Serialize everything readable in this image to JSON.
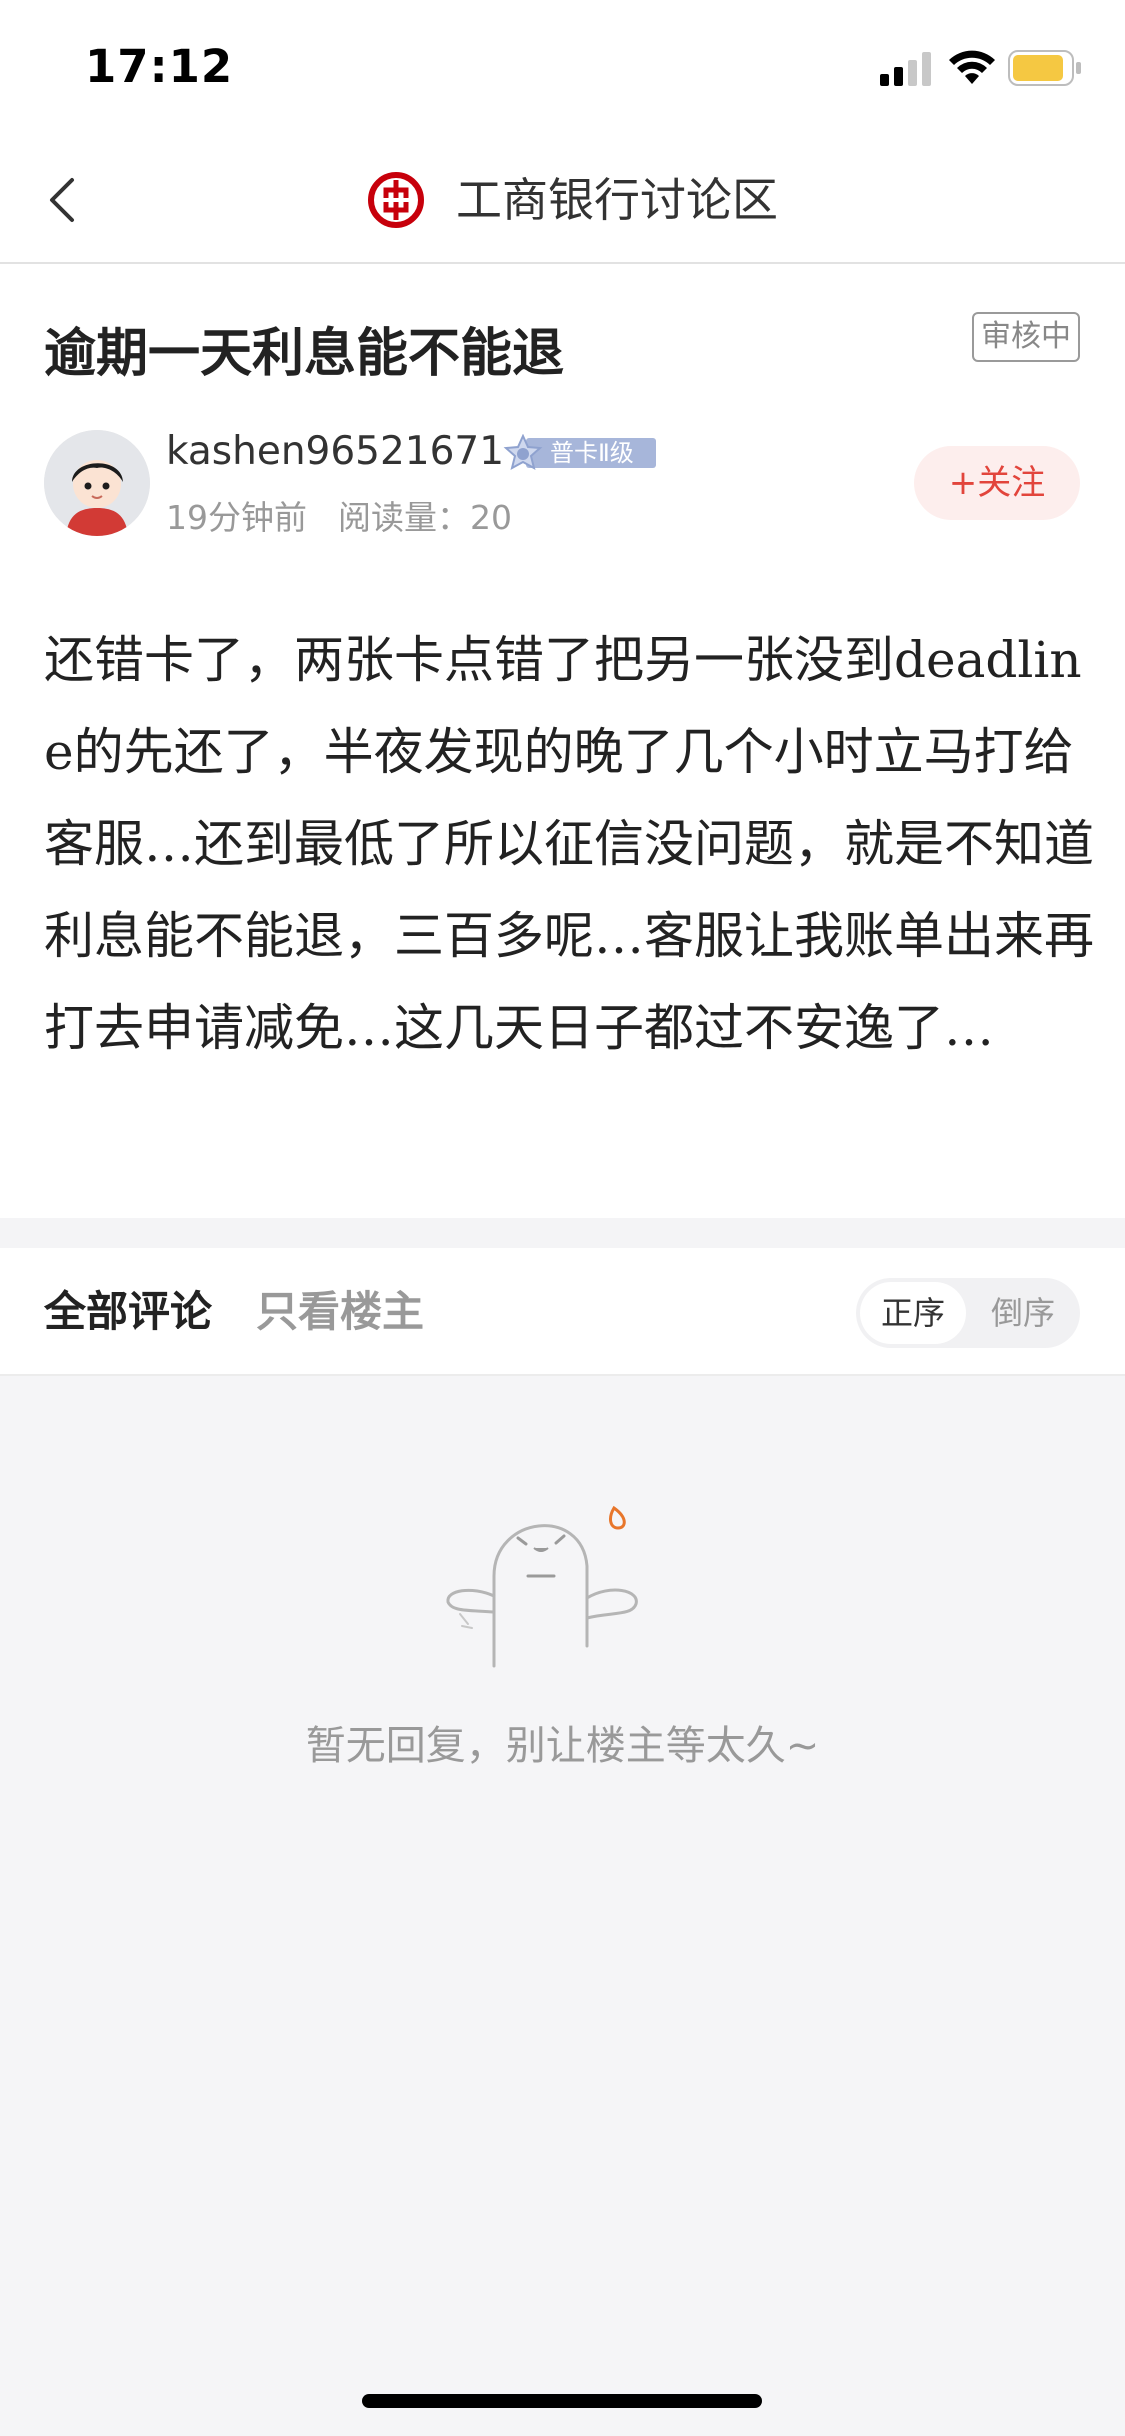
{
  "status_bar": {
    "time": "17:12",
    "icons": [
      "signal-icon",
      "wifi-icon",
      "battery-icon"
    ],
    "battery_color": "#F5C842"
  },
  "nav": {
    "back_icon": "chevron-left-icon",
    "logo_icon": "icbc-logo-icon",
    "title": "工商银行讨论区",
    "brand_color": "#C7000B"
  },
  "post": {
    "title": "逾期一天利息能不能退",
    "review_status": "审核中",
    "author": {
      "name": "kashen96521671",
      "level": "普卡Ⅱ级",
      "avatar_icon": "user-avatar"
    },
    "time_ago": "19分钟前",
    "reads": "阅读量：20",
    "follow_label": "+关注",
    "body": "还错卡了，两张卡点错了把另一张没到deadline的先还了，半夜发现的晚了几个小时立马打给客服…还到最低了所以征信没问题，就是不知道利息能不能退，三百多呢…客服让我账单出来再打去申请减免…这几天日子都过不安逸了…"
  },
  "comments": {
    "tab_all": "全部评论",
    "tab_op_only": "只看楼主",
    "sort_asc": "正序",
    "sort_desc": "倒序",
    "empty_text": "暂无回复，别让楼主等太久~",
    "empty_icon": "ghost-sweat-icon"
  },
  "colors": {
    "accent_red": "#E2453C",
    "follow_bg": "#FDEEED",
    "level_badge": "#A7B6DA",
    "sweat_drop": "#E8762B"
  }
}
